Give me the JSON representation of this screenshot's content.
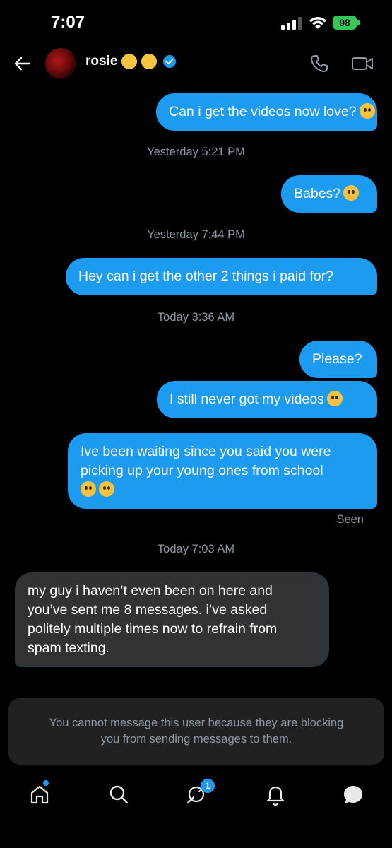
{
  "status_bar": {
    "time": "7:07",
    "battery": "98"
  },
  "header": {
    "name": "rosie"
  },
  "messages": [
    {
      "text": "Can i get the videos now love?"
    },
    {
      "text": "Babes?"
    },
    {
      "text": "Hey can i get the other 2 things i paid for?"
    },
    {
      "text": "Please?"
    },
    {
      "text": "I still never got my videos"
    },
    {
      "text": "Ive been waiting since you said you were picking up your young ones from school"
    }
  ],
  "incoming": [
    {
      "lines": [
        "my guy i haven’t even been on here and",
        "you’ve sent me 8 messages. i’ve asked",
        "politely multiple times now to refrain from",
        "spam texting."
      ]
    }
  ],
  "timestamps": [
    "Yesterday 5:21 PM",
    "Yesterday 7:44 PM",
    "Today 3:36 AM",
    "Today 7:03 AM"
  ],
  "seen_label": "Seen",
  "blocked_notice": {
    "line1": "You cannot message this user because they are blocking",
    "line2": "you from sending messages to them."
  },
  "tab_bar": {
    "messages_badge": "1"
  },
  "colors": {
    "accent": "#1d9bf0",
    "incoming_bubble": "#2f3336",
    "background": "#000000",
    "battery": "#34c759"
  },
  "icons": [
    "back-arrow-icon",
    "verified-badge-icon",
    "phone-icon",
    "video-icon",
    "home-icon",
    "search-icon",
    "messages-icon",
    "bell-icon",
    "grok-chat-icon"
  ]
}
